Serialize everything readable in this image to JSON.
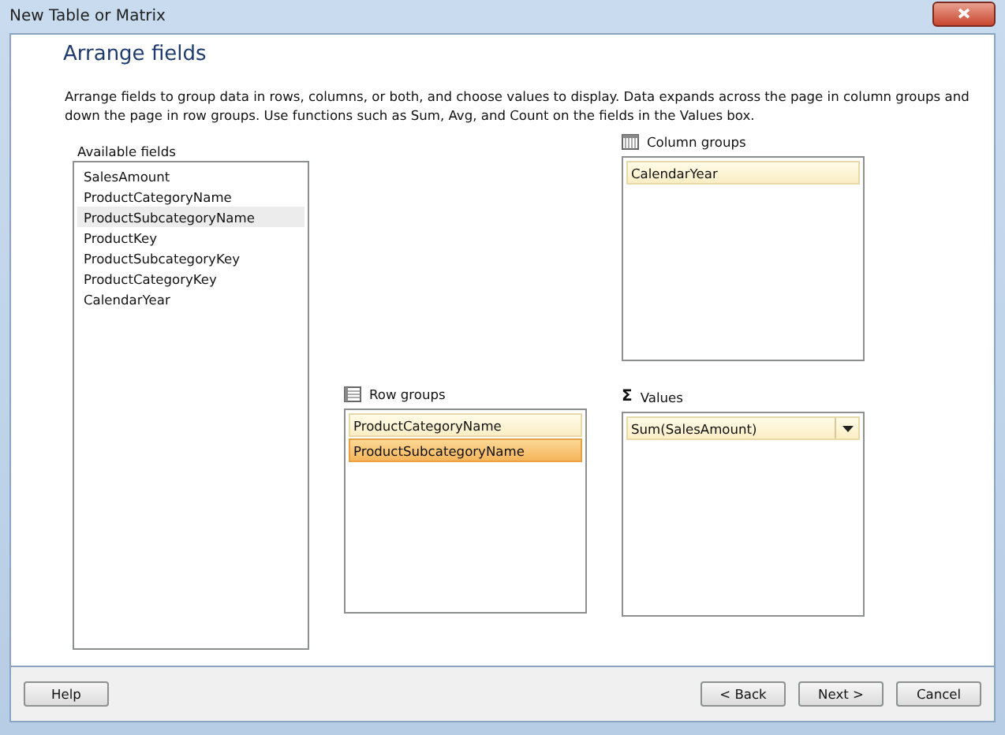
{
  "window": {
    "title": "New Table or Matrix"
  },
  "page": {
    "heading": "Arrange fields",
    "description": "Arrange fields to group data in rows, columns, or both, and choose values to display. Data expands across the page in column groups and down the page in row groups.  Use functions such as Sum, Avg, and Count on the fields in the Values box."
  },
  "available_fields": {
    "label": "Available fields",
    "items": [
      {
        "label": "SalesAmount",
        "selected": false
      },
      {
        "label": "ProductCategoryName",
        "selected": false
      },
      {
        "label": "ProductSubcategoryName",
        "selected": true
      },
      {
        "label": "ProductKey",
        "selected": false
      },
      {
        "label": "ProductSubcategoryKey",
        "selected": false
      },
      {
        "label": "ProductCategoryKey",
        "selected": false
      },
      {
        "label": "CalendarYear",
        "selected": false
      }
    ]
  },
  "column_groups": {
    "label": "Column groups",
    "items": [
      {
        "label": "CalendarYear",
        "selected": false
      }
    ]
  },
  "row_groups": {
    "label": "Row groups",
    "items": [
      {
        "label": "ProductCategoryName",
        "selected": false
      },
      {
        "label": "ProductSubcategoryName",
        "selected": true
      }
    ]
  },
  "values": {
    "icon": "Σ",
    "label": "Values",
    "items": [
      {
        "label": "Sum(SalesAmount)",
        "selected": false
      }
    ]
  },
  "buttons": {
    "left": [
      "Help"
    ],
    "right": [
      "< Back",
      "Next >",
      "Cancel"
    ]
  }
}
